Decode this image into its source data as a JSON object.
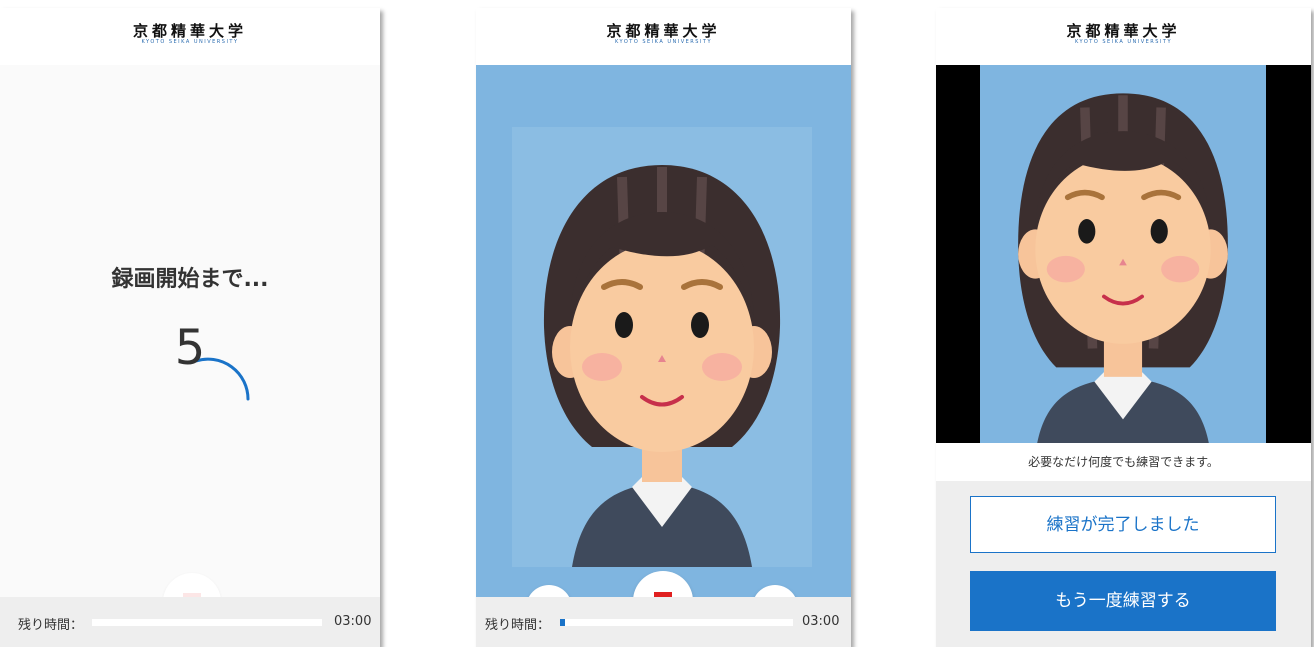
{
  "header": {
    "logo_jp": "京都精華大学",
    "logo_en": "KYOTO SEIKA UNIVERSITY"
  },
  "countdown_screen": {
    "label": "録画開始まで...",
    "count": "5"
  },
  "timer": {
    "label": "残り時間：",
    "value": "03:00"
  },
  "recording_screen": {
    "elapsed_fraction": 0.02
  },
  "icons": {
    "menu": "text-lines-icon",
    "camera_off": "video-off-icon",
    "stop": "stop-square-icon"
  },
  "practice_result": {
    "caption": "必要なだけ何度でも練習できます。",
    "complete_button": "練習が完了しました",
    "retry_button": "もう一度練習する"
  },
  "colors": {
    "accent": "#1a73c8",
    "record": "#e02020",
    "video_bg": "#7fb5e0"
  }
}
